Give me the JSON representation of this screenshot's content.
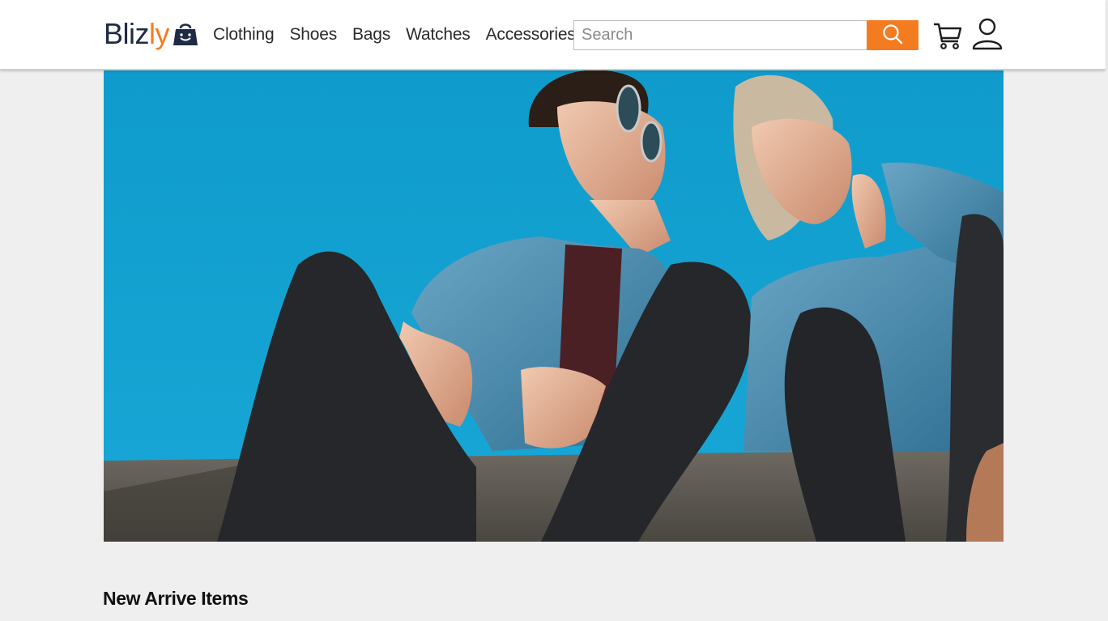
{
  "brand": {
    "name_part1": "Bliz",
    "name_part2": "ly",
    "primary_color": "#1f2a44",
    "accent_color": "#f47c20",
    "logo_icon": "shopping-bag-icon"
  },
  "nav": {
    "items": [
      {
        "label": "Clothing"
      },
      {
        "label": "Shoes"
      },
      {
        "label": "Bags"
      },
      {
        "label": "Watches"
      },
      {
        "label": "Accessories"
      }
    ]
  },
  "search": {
    "placeholder": "Search",
    "value": "",
    "button_icon": "search-icon"
  },
  "header_icons": {
    "cart": "cart-icon",
    "account": "user-icon"
  },
  "hero": {
    "image_description": "banner photo",
    "sky_color": "#129fce"
  },
  "sections": {
    "new_arrivals_title": "New Arrive Items"
  }
}
